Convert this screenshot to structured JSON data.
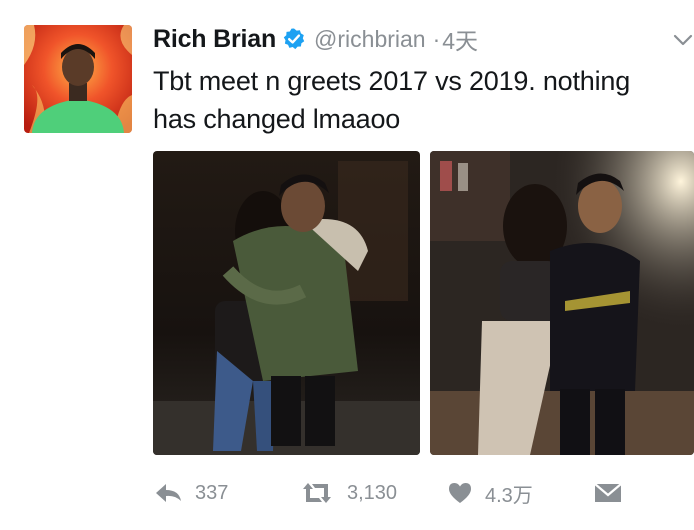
{
  "user": {
    "display_name": "Rich Brian",
    "handle": "@richbrian",
    "separator": "·",
    "time": "4天",
    "verified": true
  },
  "tweet": {
    "text_lines": [
      "Tbt meet n greets 2017 vs 2019. nothing",
      "has changed lmaaoo"
    ]
  },
  "media": [
    {
      "description_icon": "photo-2017"
    },
    {
      "description_icon": "photo-2019"
    }
  ],
  "actions": {
    "reply_count": "337",
    "retweet_count": "3,130",
    "like_count": "4.3万"
  },
  "colors": {
    "text": "#14171a",
    "muted": "#8a8f94",
    "verified": "#1da1f2"
  }
}
